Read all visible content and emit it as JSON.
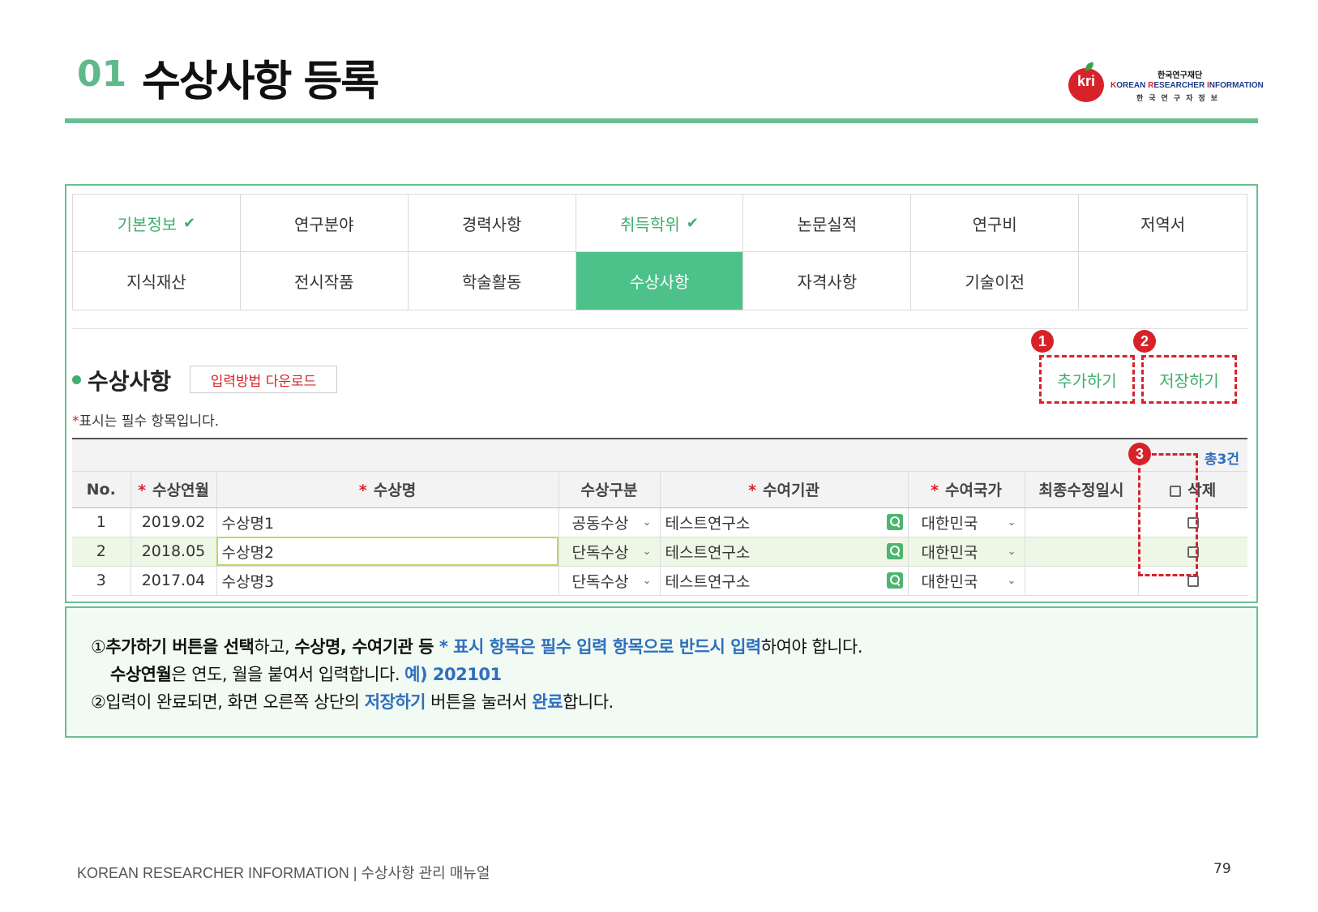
{
  "header": {
    "number": "01",
    "title": "수상사항 등록"
  },
  "logo": {
    "icon_text": "kri",
    "top": "한국연구재단",
    "mid_k": "K",
    "mid_1": "OREAN ",
    "mid_r": "R",
    "mid_2": "ESEARCHER ",
    "mid_i": "I",
    "mid_3": "NFORMATION",
    "bottom": "한국연구자정보"
  },
  "menu": {
    "row1": [
      "기본정보",
      "연구분야",
      "경력사항",
      "취득학위",
      "논문실적",
      "연구비",
      "저역서"
    ],
    "row2": [
      "지식재산",
      "전시작품",
      "학술활동",
      "수상사항",
      "자격사항",
      "기술이전",
      ""
    ],
    "check_icon": "check-icon"
  },
  "section": {
    "title": "수상사항",
    "download_label": "입력방법 다운로드",
    "required_mark": "*",
    "required_note": "표시는 필수 항목입니다."
  },
  "actions": {
    "add_label": "추가하기",
    "save_label": "저장하기",
    "badges": [
      "1",
      "2",
      "3"
    ]
  },
  "table": {
    "total": "총3건",
    "headers": {
      "no": "No.",
      "date": "수상연월",
      "name": "수상명",
      "type": "수상구분",
      "org": "수여기관",
      "country": "수여국가",
      "updated": "최종수정일시",
      "delete": "삭제"
    },
    "required_mark": "*",
    "rows": [
      {
        "no": "1",
        "date": "2019.02",
        "name": "수상명1",
        "type": "공동수상",
        "org": "테스트연구소",
        "country": "대한민국",
        "updated": ""
      },
      {
        "no": "2",
        "date": "2018.05",
        "name": "수상명2",
        "type": "단독수상",
        "org": "테스트연구소",
        "country": "대한민국",
        "updated": ""
      },
      {
        "no": "3",
        "date": "2017.04",
        "name": "수상명3",
        "type": "단독수상",
        "org": "테스트연구소",
        "country": "대한민국",
        "updated": ""
      }
    ]
  },
  "instructions": {
    "l1_mark": "①",
    "l1_a": "추가하기 버튼을 선택",
    "l1_b": "하고, ",
    "l1_c": "수상명, 수여기관 등",
    "l1_d": " * 표시 항목은 필수 입력 항목으로 반드시 입력",
    "l1_e": "하여야 합니다.",
    "l2_a": "수상연월",
    "l2_b": "은 연도, 월을 붙여서 입력합니다. ",
    "l2_c": "예) 202101",
    "l3_mark": "②",
    "l3_a": "입력이 완료되면, 화면 오른쪽 상단의 ",
    "l3_b": "저장하기",
    "l3_c": " 버튼을 눌러서 ",
    "l3_d": "완료",
    "l3_e": "합니다."
  },
  "footer": {
    "text": "KOREAN RESEARCHER INFORMATION  |  수상사항 관리 매뉴얼",
    "page": "79"
  },
  "colors": {
    "accent": "#4cc18a",
    "red": "#d8222a",
    "blue": "#2f6fbf"
  }
}
